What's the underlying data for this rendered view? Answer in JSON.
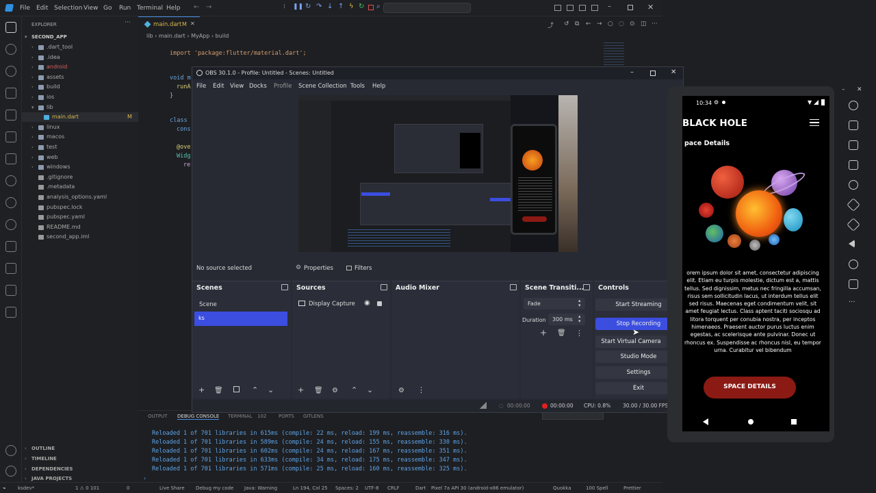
{
  "vscode": {
    "menu": [
      "File",
      "Edit",
      "Selection",
      "View",
      "Go",
      "Run",
      "Terminal",
      "Help"
    ],
    "explorer_title": "EXPLORER",
    "project": "SECOND_APP",
    "tree": [
      {
        "label": ".dart_tool",
        "type": "folder",
        "indent": 1
      },
      {
        "label": ".idea",
        "type": "folder",
        "indent": 1
      },
      {
        "label": "android",
        "type": "folder",
        "indent": 1
      },
      {
        "label": "assets",
        "type": "folder",
        "indent": 1
      },
      {
        "label": "build",
        "type": "folder",
        "indent": 1
      },
      {
        "label": "ios",
        "type": "folder",
        "indent": 1
      },
      {
        "label": "lib",
        "type": "folder-open",
        "indent": 1
      },
      {
        "label": "main.dart",
        "type": "dart",
        "indent": 2,
        "badge": "M"
      },
      {
        "label": "linux",
        "type": "folder",
        "indent": 1
      },
      {
        "label": "macos",
        "type": "folder",
        "indent": 1
      },
      {
        "label": "test",
        "type": "folder",
        "indent": 1
      },
      {
        "label": "web",
        "type": "folder",
        "indent": 1
      },
      {
        "label": "windows",
        "type": "folder",
        "indent": 1
      },
      {
        "label": ".gitignore",
        "type": "file",
        "indent": 1
      },
      {
        "label": ".metadata",
        "type": "file",
        "indent": 1
      },
      {
        "label": "analysis_options.yaml",
        "type": "file",
        "indent": 1
      },
      {
        "label": "pubspec.lock",
        "type": "file",
        "indent": 1
      },
      {
        "label": "pubspec.yaml",
        "type": "file",
        "indent": 1
      },
      {
        "label": "README.md",
        "type": "file",
        "indent": 1
      },
      {
        "label": "second_app.iml",
        "type": "file",
        "indent": 1
      }
    ],
    "sections": [
      "OUTLINE",
      "TIMELINE",
      "DEPENDENCIES",
      "JAVA PROJECTS"
    ],
    "tab": "main.dart",
    "tab_badge": "M",
    "breadcrumb": [
      "lib",
      "main.dart",
      "MyApp",
      "build"
    ],
    "code_import": "import 'package:flutter/material.dart';",
    "code_fragments": [
      "void m",
      "runA",
      "}",
      "class",
      "cons",
      "@over",
      "Widg",
      "re"
    ],
    "panel_tabs": [
      "OUTPUT",
      "DEBUG CONSOLE",
      "TERMINAL",
      "102",
      "PORTS",
      "GITLENS"
    ],
    "log_lines": [
      "Reloaded 1 of 701 libraries in 615ms (compile: 22 ms, reload: 199 ms, reassemble: 316 ms).",
      "Reloaded 1 of 701 libraries in 589ms (compile: 24 ms, reload: 155 ms, reassemble: 330 ms).",
      "Reloaded 1 of 701 libraries in 602ms (compile: 24 ms, reload: 167 ms, reassemble: 351 ms).",
      "Reloaded 1 of 701 libraries in 633ms (compile: 34 ms, reload: 175 ms, reassemble: 347 ms).",
      "Reloaded 1 of 701 libraries in 571ms (compile: 25 ms, reload: 160 ms, reassemble: 325 ms)."
    ],
    "status": {
      "left": "ksdev*",
      "errors": "1 ⚠ 0 101",
      "debug": "0",
      "live_share": "Live Share",
      "debug_mode": "Debug my code",
      "java": "Java: Warning",
      "position": "Ln 194, Col 25",
      "spaces": "Spaces: 2",
      "encoding": "UTF-8",
      "eol": "CRLF",
      "language": "Dart",
      "device": "Pixel 7a API 30 (android-x86 emulator)",
      "quokka": "Quokka",
      "spell": "100 Spell",
      "prettier": "Prettier"
    }
  },
  "obs": {
    "title": "OBS 30.1.0 - Profile: Untitled - Scenes: Untitled",
    "menu": [
      "File",
      "Edit",
      "View",
      "Docks",
      "Profile",
      "Scene Collection",
      "Tools",
      "Help"
    ],
    "no_source": "No source selected",
    "properties": "Properties",
    "filters": "Filters",
    "scenes": {
      "title": "Scenes",
      "items": [
        "Scene",
        "ks"
      ]
    },
    "sources": {
      "title": "Sources",
      "items": [
        "Display Capture"
      ]
    },
    "audio_mixer": {
      "title": "Audio Mixer"
    },
    "transitions": {
      "title": "Scene Transiti...",
      "selected": "Fade",
      "duration_label": "Duration",
      "duration_value": "300 ms"
    },
    "controls": {
      "title": "Controls",
      "start_streaming": "Start Streaming",
      "stop_recording": "Stop Recording",
      "start_virtual_camera": "Start Virtual Camera",
      "studio_mode": "Studio Mode",
      "settings": "Settings",
      "exit": "Exit"
    },
    "status": {
      "stream_time": "00:00:00",
      "rec_time": "00:00:00",
      "cpu": "CPU: 0.8%",
      "fps": "30.00 / 30.00 FPS"
    },
    "colors": {
      "accent": "#3b4ee0",
      "bg": "#272a33"
    }
  },
  "phone": {
    "time": "10:34",
    "title": "BLACK HOLE",
    "subtitle": "pace Details",
    "body": "orem ipsum dolor sit amet, consectetur adipiscing elit. Etiam eu turpis molestie, dictum est a, mattis tellus. Sed dignissim, metus nec fringilla accumsan, risus sem sollicitudin lacus, ut interdum tellus elit sed risus. Maecenas eget condimentum velit, sit amet feugiat lectus. Class aptent taciti sociosqu ad litora torquent per conubia nostra, per inceptos himenaeos. Praesent auctor purus luctus enim egestas, ac scelerisque ante pulvinar. Donec ut rhoncus ex. Suspendisse ac rhoncus nisl, eu tempor urna. Curabitur vel bibendum",
    "button": "SPACE DETAILS",
    "button_color": "#8b1a14"
  }
}
